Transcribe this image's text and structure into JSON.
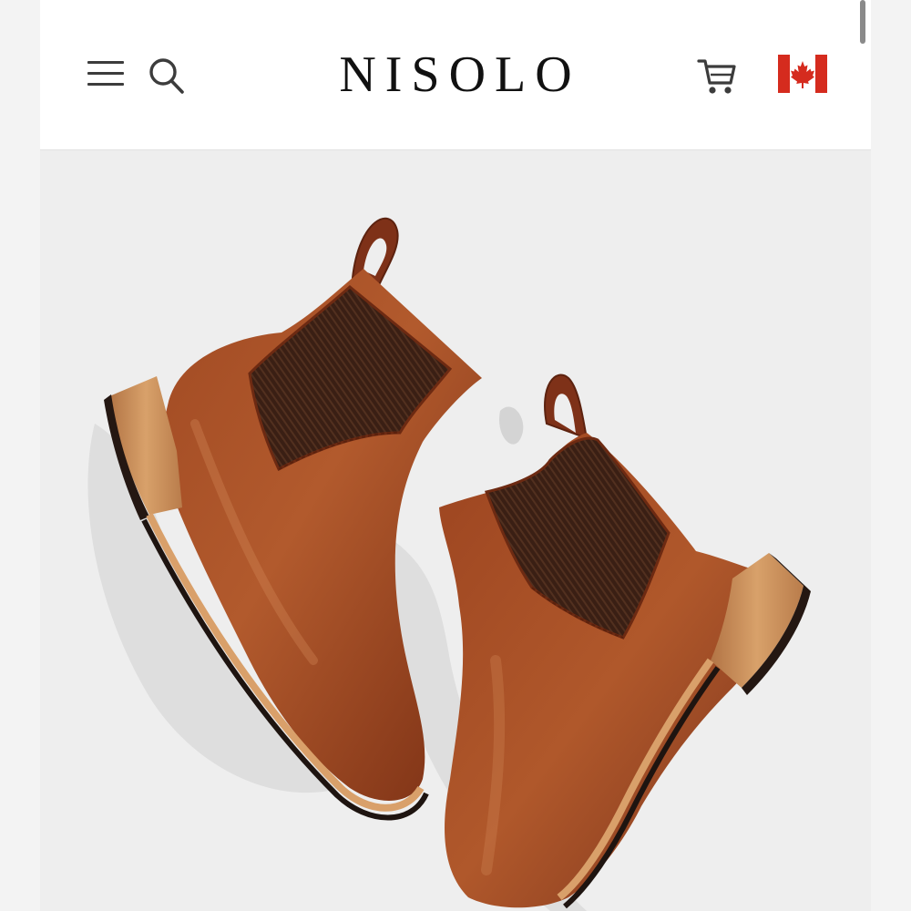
{
  "header": {
    "brand": "NISOLO",
    "menu_icon": "hamburger-menu-icon",
    "search_icon": "search-icon",
    "cart_icon": "shopping-cart-icon",
    "region_icon": "canada-flag-icon"
  },
  "hero": {
    "image": "product-photo-chelsea-boots-brown-leather"
  },
  "colors": {
    "header_bg": "#ffffff",
    "page_bg": "#eeeeee",
    "logo": "#111111",
    "icon": "#3c3c3c",
    "flag_red": "#d52b1e",
    "leather": "#8e3b1c",
    "elastic": "#3a1f14",
    "sole_wood": "#c98f57"
  }
}
